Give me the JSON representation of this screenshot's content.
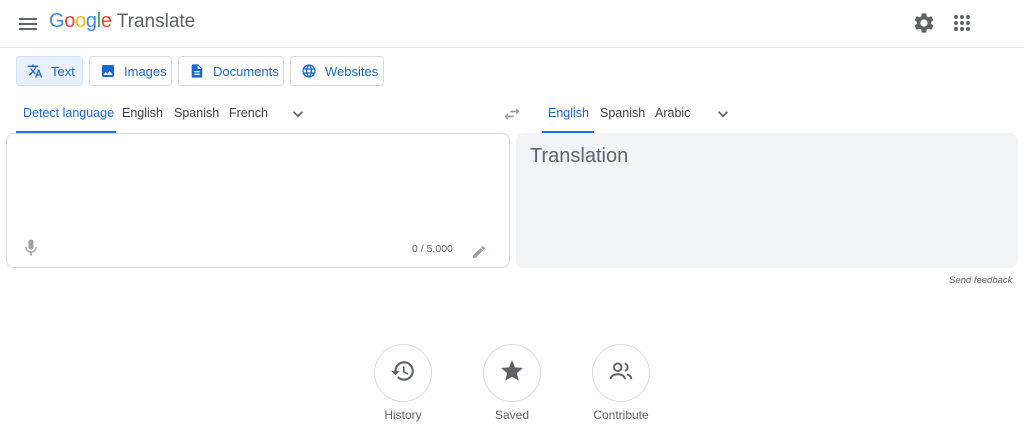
{
  "header": {
    "logo_letters": [
      {
        "ch": "G",
        "color": "#4285F4"
      },
      {
        "ch": "o",
        "color": "#EA4335"
      },
      {
        "ch": "o",
        "color": "#FBBC05"
      },
      {
        "ch": "g",
        "color": "#4285F4"
      },
      {
        "ch": "l",
        "color": "#34A853"
      },
      {
        "ch": "e",
        "color": "#EA4335"
      }
    ],
    "logo_google": "Google",
    "product": "Translate",
    "menu_icon": "hamburger-menu-icon",
    "settings_icon": "gear-icon",
    "apps_icon": "apps-grid-icon"
  },
  "modes": {
    "text": "Text",
    "images": "Images",
    "documents": "Documents",
    "websites": "Websites",
    "active": "Text"
  },
  "source_langs": {
    "detect": "Detect language",
    "l1": "English",
    "l2": "Spanish",
    "l3": "French",
    "active": "Detect language"
  },
  "target_langs": {
    "l1": "English",
    "l2": "Spanish",
    "l3": "Arabic",
    "active": "English"
  },
  "source": {
    "value": "",
    "counter": "0 / 5,000"
  },
  "target": {
    "placeholder": "Translation"
  },
  "feedback": "Send feedback",
  "actions": {
    "history": "History",
    "saved": "Saved",
    "contribute": "Contribute"
  },
  "colors": {
    "accent": "#1a73e8",
    "active_tab_bg": "#e8f0fe",
    "panel_bg": "#f1f3f4",
    "border": "#dadce0"
  }
}
